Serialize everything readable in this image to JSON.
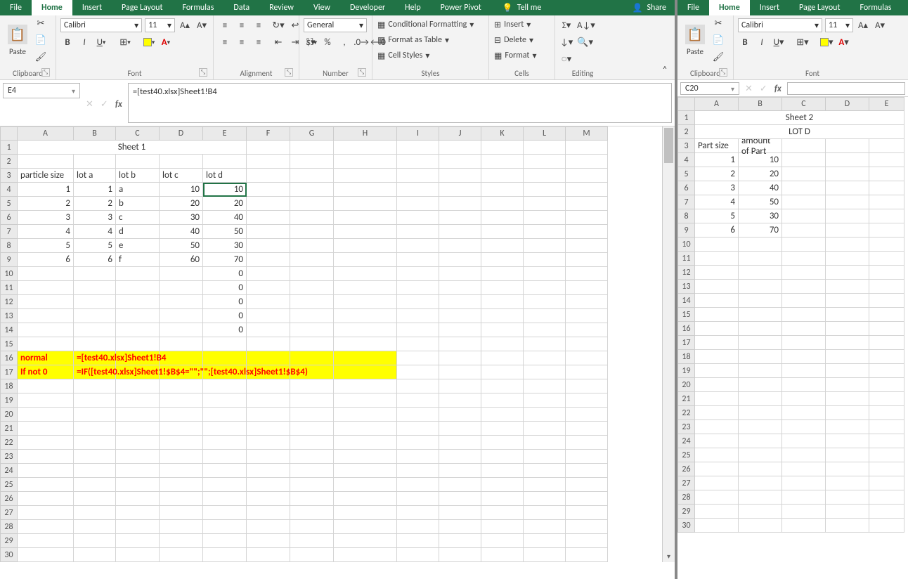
{
  "left": {
    "tabs": [
      "File",
      "Home",
      "Insert",
      "Page Layout",
      "Formulas",
      "Data",
      "Review",
      "View",
      "Developer",
      "Help",
      "Power Pivot"
    ],
    "activeTab": 1,
    "tellme": "Tell me",
    "share": "Share",
    "ribbon": {
      "clipboard": {
        "paste": "Paste",
        "label": "Clipboard"
      },
      "font": {
        "name": "Calibri",
        "size": "11",
        "label": "Font"
      },
      "alignment": {
        "label": "Alignment"
      },
      "number": {
        "format": "General",
        "label": "Number"
      },
      "styles": {
        "condfmt": "Conditional Formatting",
        "table": "Format as Table",
        "cellstyles": "Cell Styles",
        "label": "Styles"
      },
      "cells": {
        "insert": "Insert",
        "delete": "Delete",
        "format": "Format",
        "label": "Cells"
      },
      "editing": {
        "label": "Editing"
      }
    },
    "cellref": "E4",
    "formula": "=[test40.xlsx]Sheet1!B4",
    "cols": [
      "A",
      "B",
      "C",
      "D",
      "E",
      "F",
      "G",
      "H",
      "I",
      "J",
      "K",
      "L",
      "M"
    ],
    "cw": [
      80,
      60,
      62,
      62,
      62,
      62,
      62,
      90,
      60,
      60,
      60,
      60,
      60
    ],
    "rows": 30,
    "selected": {
      "r": 4,
      "c": 5
    },
    "sheetTitle": "Sheet 1",
    "data": {
      "3": {
        "1": "particle size",
        "2": "lot a",
        "3": "lot b",
        "4": "lot c",
        "5": "lot d"
      },
      "4": {
        "1": "1",
        "2": "1",
        "3": "a",
        "4": "10",
        "5": "10"
      },
      "5": {
        "1": "2",
        "2": "2",
        "3": "b",
        "4": "20",
        "5": "20"
      },
      "6": {
        "1": "3",
        "2": "3",
        "3": "c",
        "4": "30",
        "5": "40"
      },
      "7": {
        "1": "4",
        "2": "4",
        "3": "d",
        "4": "40",
        "5": "50"
      },
      "8": {
        "1": "5",
        "2": "5",
        "3": "e",
        "4": "50",
        "5": "30"
      },
      "9": {
        "1": "6",
        "2": "6",
        "3": "f",
        "4": "60",
        "5": "70"
      },
      "10": {
        "5": "0"
      },
      "11": {
        "5": "0"
      },
      "12": {
        "5": "0"
      },
      "13": {
        "5": "0"
      },
      "14": {
        "5": "0"
      }
    },
    "right_align": {
      "3": {},
      "4": {
        "1": 1,
        "2": 1,
        "4": 1,
        "5": 1
      },
      "5": {
        "1": 1,
        "2": 1,
        "4": 1,
        "5": 1
      },
      "6": {
        "1": 1,
        "2": 1,
        "4": 1,
        "5": 1
      },
      "7": {
        "1": 1,
        "2": 1,
        "4": 1,
        "5": 1
      },
      "8": {
        "1": 1,
        "2": 1,
        "4": 1,
        "5": 1
      },
      "9": {
        "1": 1,
        "2": 1,
        "4": 1,
        "5": 1
      },
      "10": {
        "5": 1
      },
      "11": {
        "5": 1
      },
      "12": {
        "5": 1
      },
      "13": {
        "5": 1
      },
      "14": {
        "5": 1
      }
    },
    "highlight": [
      {
        "r": 16,
        "c1": 1,
        "c2": 8,
        "labelCell": "normal",
        "textCell": "=[test40.xlsx]Sheet1!B4"
      },
      {
        "r": 17,
        "c1": 1,
        "c2": 8,
        "labelCell": "If not 0",
        "textCell": "=IF([test40.xlsx]Sheet1!$B$4=\"\";\"\";[test40.xlsx]Sheet1!$B$4)"
      }
    ]
  },
  "right": {
    "tabs": [
      "File",
      "Home",
      "Insert",
      "Page Layout",
      "Formulas"
    ],
    "activeTab": 1,
    "ribbon": {
      "clipboard": {
        "paste": "Paste",
        "label": "Clipboard"
      },
      "font": {
        "name": "Calibri",
        "size": "11",
        "label": "Font"
      }
    },
    "cellref": "C20",
    "formula": "",
    "cols": [
      "A",
      "B",
      "C",
      "D",
      "E"
    ],
    "cw": [
      62,
      62,
      62,
      62,
      50
    ],
    "rows": 30,
    "sheetTitle": "Sheet 2",
    "sheetSub": "LOT D",
    "data": {
      "3": {
        "1": "Part size",
        "2": "amount of Part"
      },
      "4": {
        "1": "1",
        "2": "10"
      },
      "5": {
        "1": "2",
        "2": "20"
      },
      "6": {
        "1": "3",
        "2": "40"
      },
      "7": {
        "1": "4",
        "2": "50"
      },
      "8": {
        "1": "5",
        "2": "30"
      },
      "9": {
        "1": "6",
        "2": "70"
      }
    },
    "right_align": {
      "4": {
        "1": 1,
        "2": 1
      },
      "5": {
        "1": 1,
        "2": 1
      },
      "6": {
        "1": 1,
        "2": 1
      },
      "7": {
        "1": 1,
        "2": 1
      },
      "8": {
        "1": 1,
        "2": 1
      },
      "9": {
        "1": 1,
        "2": 1
      }
    }
  }
}
